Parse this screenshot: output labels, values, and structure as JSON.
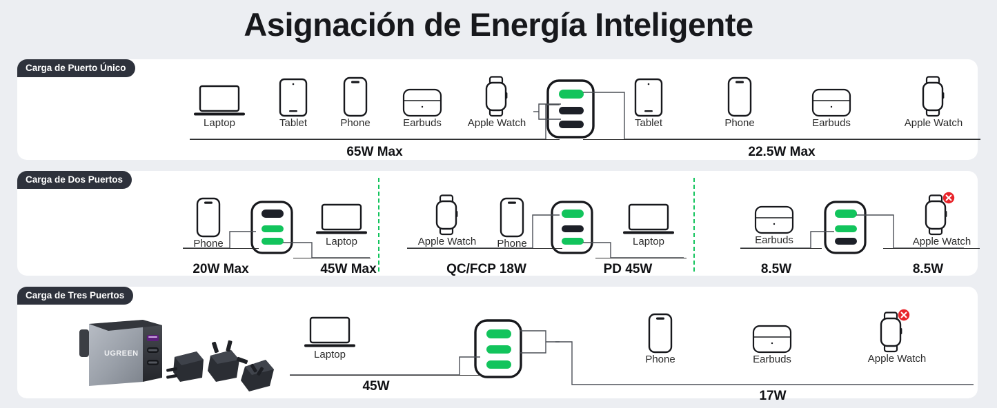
{
  "page": {
    "title": "Asignación de Energía Inteligente",
    "background_color": "#eceef2",
    "card_color": "#ffffff",
    "accent_green": "#12c45c",
    "port_dark": "#1d2028",
    "badge_color": "#2e323c",
    "error_red": "#e8242a"
  },
  "sections": [
    {
      "badge": "Carga de Puerto Único",
      "groups": [
        {
          "devices": [
            {
              "label": "Laptop",
              "icon": "laptop-icon"
            },
            {
              "label": "Tablet",
              "icon": "tablet-icon"
            },
            {
              "label": "Phone",
              "icon": "phone-icon"
            },
            {
              "label": "Earbuds",
              "icon": "earbuds-icon"
            },
            {
              "label": "Apple Watch",
              "icon": "apple-watch-icon"
            }
          ],
          "wattage": "65W  Max"
        },
        {
          "devices": [
            {
              "label": "Tablet",
              "icon": "tablet-icon"
            },
            {
              "label": "Phone",
              "icon": "phone-icon"
            },
            {
              "label": "Earbuds",
              "icon": "earbuds-icon"
            },
            {
              "label": "Apple Watch",
              "icon": "apple-watch-icon"
            }
          ],
          "wattage": "22.5W  Max"
        }
      ],
      "charger": {
        "ports": [
          "green",
          "dark",
          "dark"
        ]
      }
    },
    {
      "badge": "Carga de Dos Puertos",
      "blocks": [
        {
          "left_device": {
            "label": "Phone",
            "icon": "phone-icon"
          },
          "right_device": {
            "label": "Laptop",
            "icon": "laptop-icon"
          },
          "left_wattage": "20W Max",
          "right_wattage": "45W Max",
          "charger": {
            "ports": [
              "dark",
              "green",
              "green"
            ]
          }
        },
        {
          "left_devices": [
            {
              "label": "Apple Watch",
              "icon": "apple-watch-icon"
            },
            {
              "label": "Phone",
              "icon": "phone-icon"
            }
          ],
          "right_device": {
            "label": "Laptop",
            "icon": "laptop-icon"
          },
          "left_wattage": "QC/FCP 18W",
          "right_wattage": "PD 45W",
          "charger": {
            "ports": [
              "green",
              "dark",
              "green"
            ]
          }
        },
        {
          "left_device": {
            "label": "Earbuds",
            "icon": "earbuds-icon"
          },
          "right_device": {
            "label": "Apple Watch",
            "icon": "apple-watch-icon",
            "error": true
          },
          "left_wattage": "8.5W",
          "right_wattage": "8.5W",
          "charger": {
            "ports": [
              "green",
              "green",
              "dark"
            ]
          }
        }
      ]
    },
    {
      "badge": "Carga de Tres Puertos",
      "product": {
        "brand": "UGREEN",
        "name": "ugreen-charger-photo"
      },
      "left_device": {
        "label": "Laptop",
        "icon": "laptop-icon"
      },
      "left_wattage": "45W",
      "charger": {
        "ports": [
          "green",
          "green",
          "green"
        ]
      },
      "right_devices": [
        {
          "label": "Phone",
          "icon": "phone-icon"
        },
        {
          "label": "Earbuds",
          "icon": "earbuds-icon"
        },
        {
          "label": "Apple Watch",
          "icon": "apple-watch-icon",
          "error": true
        }
      ],
      "right_wattage": "17W"
    }
  ]
}
